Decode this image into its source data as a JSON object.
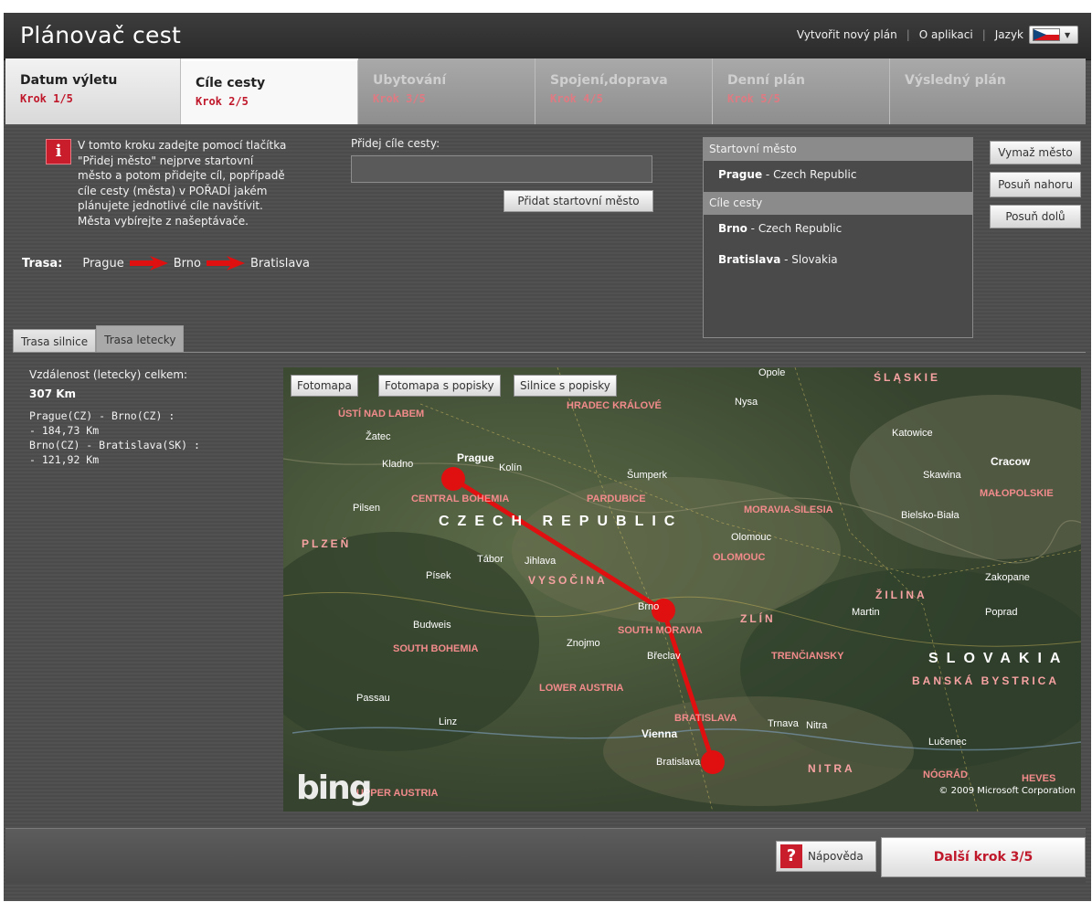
{
  "app": {
    "title": "Plánovač cest",
    "links": {
      "new_plan": "Vytvořit nový plán",
      "about": "O aplikaci",
      "language": "Jazyk"
    },
    "language_flag": "czech-flag-icon"
  },
  "steps": [
    {
      "title": "Datum výletu",
      "num": "Krok 1/5",
      "state": "done"
    },
    {
      "title": "Cíle cesty",
      "num": "Krok 2/5",
      "state": "active"
    },
    {
      "title": "Ubytování",
      "num": "Krok 3/5",
      "state": "future"
    },
    {
      "title": "Spojení,doprava",
      "num": "Krok 4/5",
      "state": "future"
    },
    {
      "title": "Denní plán",
      "num": "Krok 5/5",
      "state": "future"
    },
    {
      "title": "Výsledný plán",
      "num": "",
      "state": "future"
    }
  ],
  "info": {
    "icon": "info-icon",
    "text": "V tomto kroku zadejte pomocí tlačítka\n\"Přidej město\" nejprve startovní\nměsto a potom  přidejte cíl, popřípadě\ncíle cesty (města) v POŘADÍ jakém\nplánujete jednotlivé cíle navštívit.\nMěsta vybírejte z našeptávače."
  },
  "route": {
    "label": "Trasa:",
    "cities": [
      "Prague",
      "Brno",
      "Bratislava"
    ]
  },
  "add": {
    "label": "Přidej cíle cesty:",
    "input_value": "",
    "button": "Přidat startovní město"
  },
  "cities_panel": {
    "start_header": "Startovní město",
    "start": {
      "name": "Prague",
      "country": "Czech Republic"
    },
    "dest_header": "Cíle cesty",
    "destinations": [
      {
        "name": "Brno",
        "country": "Czech Republic"
      },
      {
        "name": "Bratislava",
        "country": "Slovakia"
      }
    ]
  },
  "city_buttons": {
    "remove": "Vymaž město",
    "up": "Posuň nahoru",
    "down": "Posuň dolů"
  },
  "route_tabs": {
    "road": "Trasa silnice",
    "air": "Trasa letecky"
  },
  "distance": {
    "title": "Vzdálenost (letecky) celkem:",
    "total": "307 Km",
    "legs": "Prague(CZ) - Brno(CZ) :\n - 184,73 Km\nBrno(CZ) - Bratislava(SK) :\n - 121,92 Km"
  },
  "map": {
    "types": [
      "Fotomapa",
      "Fotomapa s popisky",
      "Silnice s popisky"
    ],
    "logo": "bing",
    "copyright": "© 2009 Microsoft Corporation",
    "route_color": "#e01010",
    "labels": {
      "prague": "Prague",
      "brno": "Brno",
      "bratislava": "Bratislava",
      "vienna": "Vienna",
      "czech": "CZECH REPUBLIC",
      "slovakia": "SLOVAKIA",
      "central_bohemia": "CENTRAL BOHEMIA",
      "south_bohemia": "SOUTH BOHEMIA",
      "south_moravia": "SOUTH MORAVIA",
      "lower_austria": "LOWER AUSTRIA",
      "upper_austria": "UPPER AUSTRIA",
      "usti": "ÚSTÍ NAD LABEM",
      "hradec": "HRADEC KRÁLOVÉ",
      "pardubice": "PARDUBICE",
      "moravia_silesia": "MORAVIA-SILESIA",
      "olomouc": "OLOMOUC",
      "vysocina": "VYSOČINA",
      "plzen": "PLZEŇ",
      "zlin": "ZLÍN",
      "trencin": "TRENČIANSKY",
      "nitra": "NITRA",
      "banska": "BANSKÁ BYSTRICA",
      "slaskie": "ŚLĄSKIE",
      "malopolskie": "MAŁOPOLSKIE",
      "bratislava_r": "BRATISLAVA",
      "linz": "Linz",
      "passau": "Passau",
      "pilsen": "Pilsen",
      "kladno": "Kladno",
      "olomouc_c": "Olomouc",
      "trnava": "TRNAVA",
      "nograd": "NÓGRÁD",
      "heves": "HEVES",
      "cracow": "Cracow",
      "katowice": "Katowice",
      "zilina": "ŽILINA",
      "tabor": "Tábor",
      "jihlava": "Jihlava",
      "znojmo": "Znojmo",
      "breclav": "Břeclav",
      "budweis": "Budweis",
      "pisek": "Písek",
      "kolin": "Kolín",
      "zatec": "Žatec",
      "nitra_c": "Nitra",
      "trnava_c": "Trnava",
      "lucenec": "Lučenec",
      "ostrava_region": "ŠUMPERK",
      "sumperk": "Šumperk",
      "nysa": "Nysa",
      "opole": "Opole",
      "skawina": "Skawina",
      "bielsko": "Bielsko-Biała",
      "zakopane": "Zakopane",
      "poprad": "Poprad",
      "martin": "Martin"
    }
  },
  "footer": {
    "help": "Nápověda",
    "next": "Další krok 3/5"
  }
}
